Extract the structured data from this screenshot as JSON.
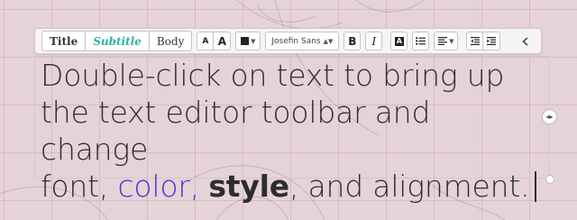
{
  "colors": {
    "background": "#e6d3d7",
    "accent_text": "#4b32d8",
    "subtitle": "#2fb3a3"
  },
  "toolbar": {
    "title_label": "Title",
    "subtitle_label": "Subtitle",
    "body_label": "Body",
    "font_size_down_label": "A",
    "font_size_up_label": "A",
    "font_name": "Josefin Sans",
    "bold_label": "B",
    "italic_label": "I",
    "highlight_label": "A",
    "icons": [
      "color-swatch-icon",
      "chevron-down-icon",
      "bulleted-list-icon",
      "align-left-icon",
      "outdent-icon",
      "indent-icon",
      "collapse-chevron-icon"
    ]
  },
  "editor": {
    "line1": "Double-click on text to bring up",
    "line2": "the text editor toolbar and change",
    "line3_prefix": "font, ",
    "line3_color": "color,",
    "line3_space": " ",
    "line3_style": "style",
    "line3_suffix": ", and alignment."
  }
}
